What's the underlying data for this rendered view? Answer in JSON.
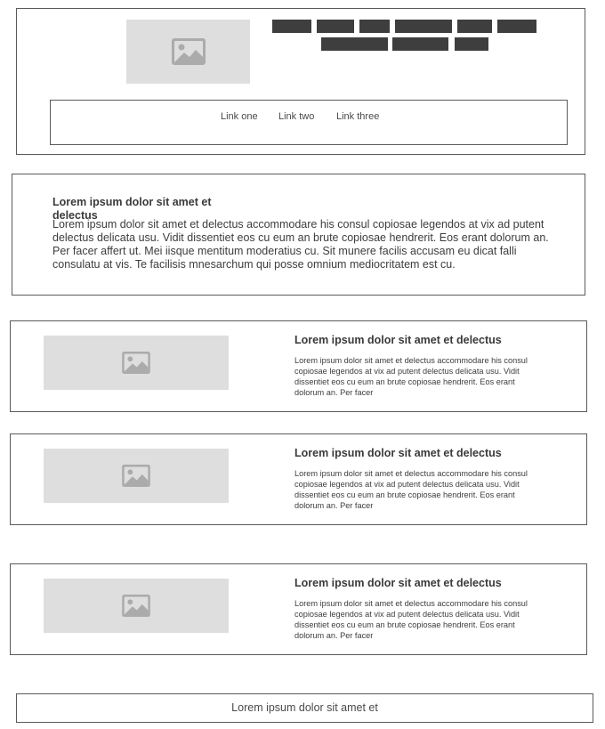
{
  "header": {
    "logo_icon": "image-placeholder-icon",
    "button_rows": [
      [
        "",
        "",
        "",
        "",
        "",
        ""
      ],
      [
        "",
        "",
        ""
      ]
    ],
    "nav_links": [
      "Link one",
      "Link two",
      "Link three"
    ]
  },
  "intro": {
    "title": "Lorem ipsum dolor sit amet et delectus",
    "body": "Lorem ipsum dolor sit amet et delectus accommodare his consul copiosae legendos at vix ad putent delectus delicata usu. Vidit dissentiet eos cu eum an brute copiosae hendrerit. Eos erant dolorum an. Per facer affert ut. Mei iisque mentitum moderatius cu. Sit munere facilis accusam eu dicat falli consulatu at vis. Te facilisis mnesarchum qui posse omnium mediocritatem est cu."
  },
  "cards": [
    {
      "image_icon": "image-placeholder-icon",
      "title": "Lorem ipsum dolor sit amet et delectus",
      "text": "Lorem ipsum dolor sit amet et delectus accommodare his consul copiosae legendos at vix ad putent delectus delicata usu. Vidit dissentiet eos cu eum an brute copiosae hendrerit. Eos erant dolorum an. Per facer"
    },
    {
      "image_icon": "image-placeholder-icon",
      "title": "Lorem ipsum dolor sit amet et delectus",
      "text": "Lorem ipsum dolor sit amet et delectus accommodare his consul copiosae legendos at vix ad putent delectus delicata usu. Vidit dissentiet eos cu eum an brute copiosae hendrerit. Eos erant dolorum an. Per facer"
    },
    {
      "image_icon": "image-placeholder-icon",
      "title": "Lorem ipsum dolor sit amet et delectus",
      "text": "Lorem ipsum dolor sit amet et delectus accommodare his consul copiosae legendos at vix ad putent delectus delicata usu. Vidit dissentiet eos cu eum an brute copiosae hendrerit. Eos erant dolorum an. Per facer"
    }
  ],
  "footer": {
    "text": "Lorem ipsum dolor sit amet et"
  },
  "colors": {
    "placeholder_bg": "#dedede",
    "placeholder_icon": "#ababab",
    "button_fill": "#3e3e3e",
    "border": "#5a5a5a",
    "text": "#3d3d3d"
  }
}
